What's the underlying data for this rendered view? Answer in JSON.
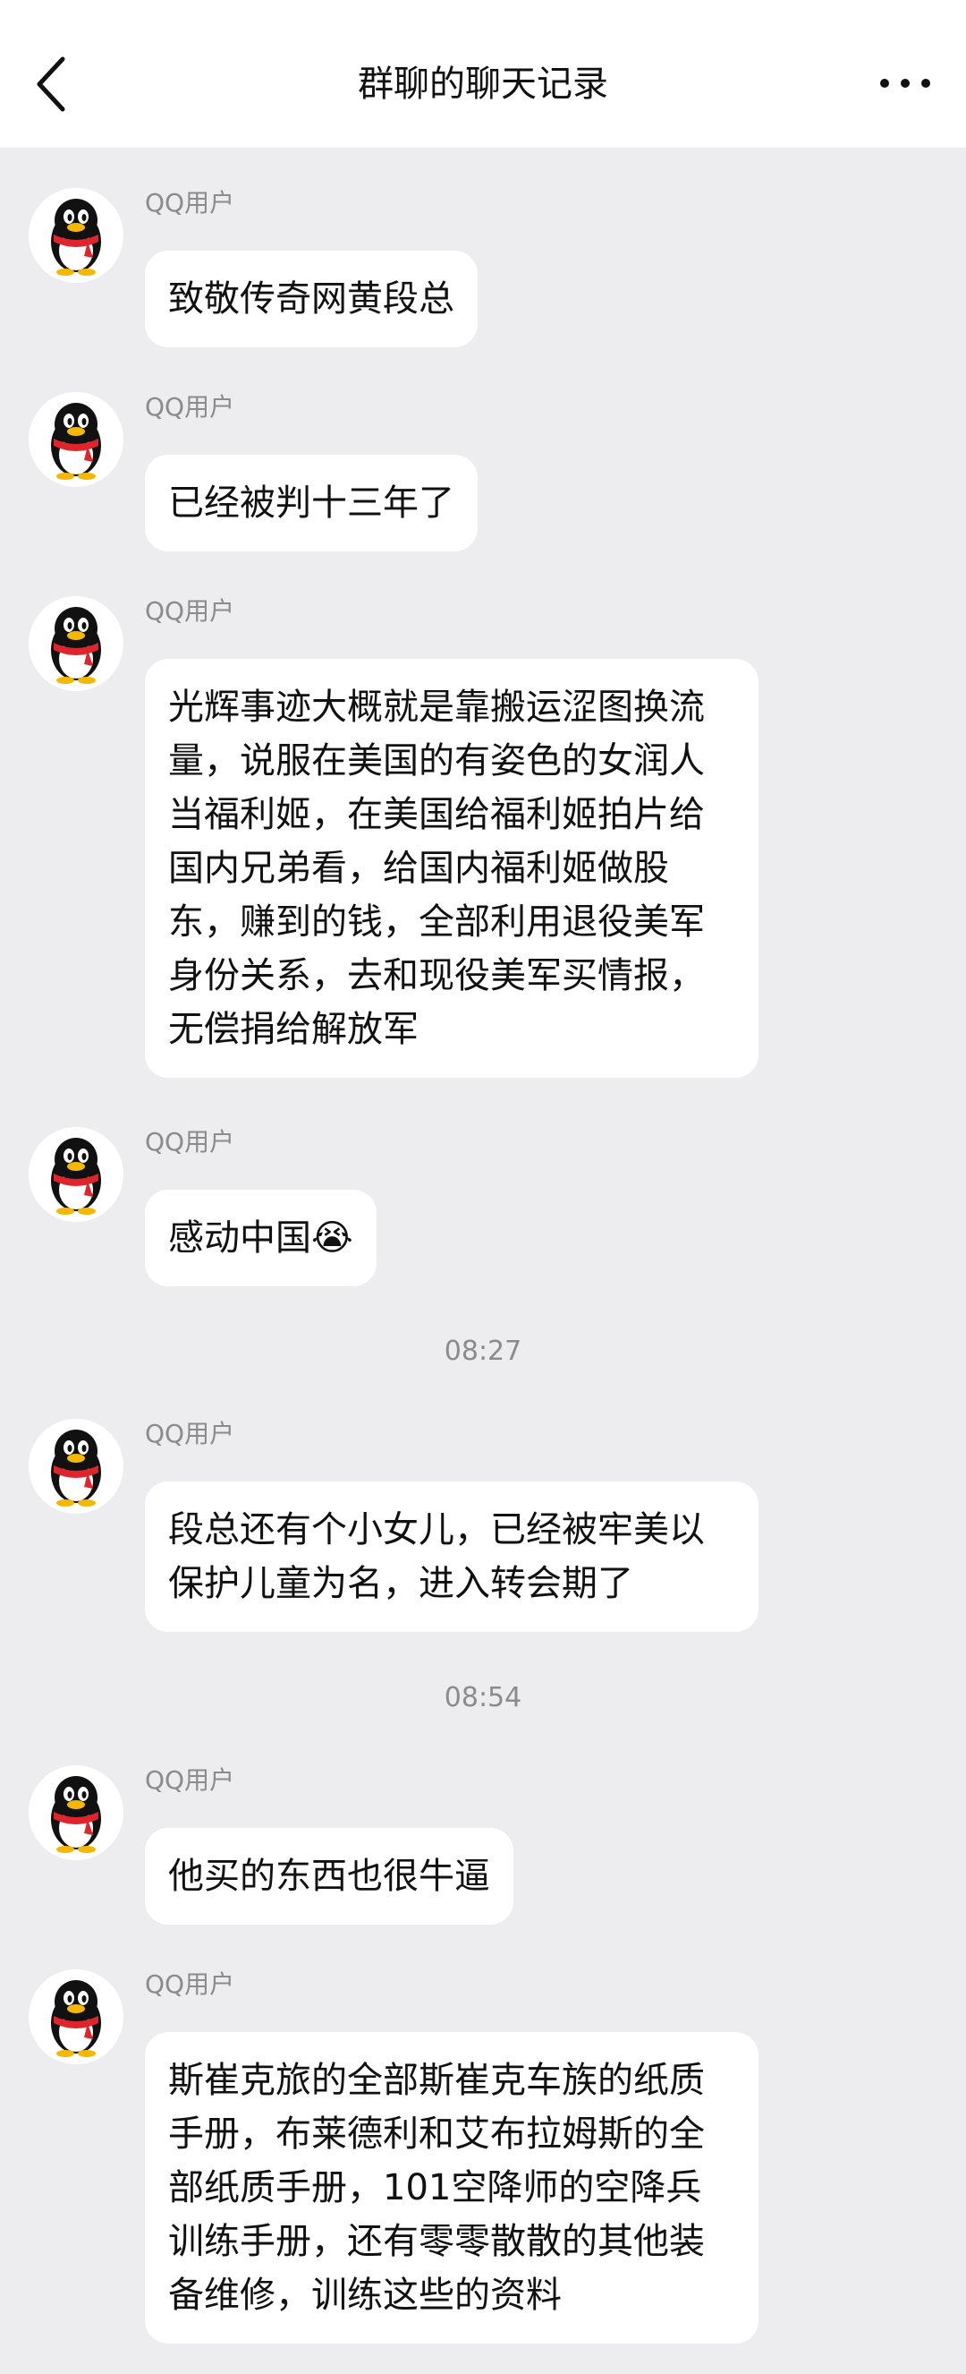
{
  "header": {
    "title": "群聊的聊天记录"
  },
  "messages": [
    {
      "sender": "QQ用户",
      "text": "致敬传奇网黄段总"
    },
    {
      "sender": "QQ用户",
      "text": "已经被判十三年了"
    },
    {
      "sender": "QQ用户",
      "text": "光辉事迹大概就是靠搬运涩图换流量，说服在美国的有姿色的女润人当福利姬，在美国给福利姬拍片给国内兄弟看，给国内福利姬做股东，赚到的钱，全部利用退役美军身份关系，去和现役美军买情报，无偿捐给解放军"
    },
    {
      "sender": "QQ用户",
      "text": "感动中国😭"
    },
    {
      "sender": "QQ用户",
      "text": "段总还有个小女儿，已经被牢美以保护儿童为名，进入转会期了"
    },
    {
      "sender": "QQ用户",
      "text": "他买的东西也很牛逼"
    },
    {
      "sender": "QQ用户",
      "text": "斯崔克旅的全部斯崔克车族的纸质手册，布莱德利和艾布拉姆斯的全部纸质手册，101空降师的空降兵训练手册，还有零零散散的其他装备维修，训练这些的资料"
    }
  ],
  "timestamps": [
    "08:27",
    "08:54"
  ],
  "icons": {
    "back": "chevron-left-icon",
    "more": "more-dots-icon",
    "avatar": "qq-penguin-avatar"
  },
  "colors": {
    "background": "#ededf0",
    "bubble": "#ffffff",
    "secondary_text": "#8a8a8f",
    "scarf_red": "#e0242b",
    "beak_yellow": "#f5b800"
  }
}
